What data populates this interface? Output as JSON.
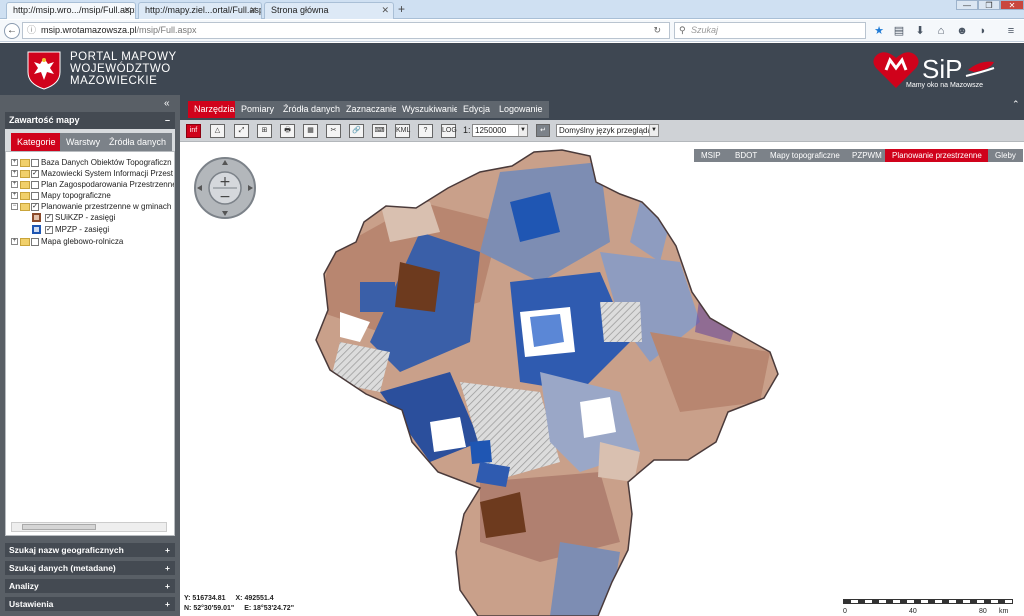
{
  "browser": {
    "tabs": [
      {
        "label": "http://msip.wro.../msip/Full.aspx",
        "active": true
      },
      {
        "label": "http://mapy.ziel...ortal/Full.aspx",
        "active": false
      },
      {
        "label": "Strona główna",
        "active": false
      }
    ],
    "new_tab": "+",
    "url_domain": "msip.wrotamazowsza.pl",
    "url_path": "/msip/Full.aspx",
    "search_placeholder": "Szukaj"
  },
  "portal": {
    "title_lines": [
      "PORTAL MAPOWY",
      "WOJEWÓDZTWO",
      "MAZOWIECKIE"
    ],
    "logo_text": "SiP",
    "logo_tagline": "Mamy oko na Mazowsze",
    "brand_color": "#d0021b"
  },
  "left_panel": {
    "collapse_glyph": "«",
    "header": "Zawartość mapy",
    "header_toggle": "–",
    "tabs": [
      "Kategorie",
      "Warstwy",
      "Źródła danych"
    ],
    "tree": [
      {
        "label": "Baza Danych Obiektów Topograficzn",
        "checked": false,
        "expanded": false,
        "indent": 0
      },
      {
        "label": "Mazowiecki System Informacji Przest",
        "checked": true,
        "expanded": false,
        "indent": 0
      },
      {
        "label": "Plan Zagospodarowania Przestrzenne",
        "checked": false,
        "expanded": false,
        "indent": 0
      },
      {
        "label": "Mapy topograficzne",
        "checked": false,
        "expanded": false,
        "indent": 0
      },
      {
        "label": "Planowanie przestrzenne w gminach",
        "checked": true,
        "expanded": true,
        "indent": 0
      },
      {
        "label": "SUiKZP - zasięgi",
        "checked": true,
        "swatch": "#8b4a2b",
        "indent": 1
      },
      {
        "label": "MPZP - zasięgi",
        "checked": true,
        "swatch": "#1f56b3",
        "indent": 1
      },
      {
        "label": "Mapa glebowo-rolnicza",
        "checked": false,
        "expanded": false,
        "indent": 0
      }
    ],
    "sections": [
      {
        "label": "Szukaj nazw geograficznych",
        "toggle": "+"
      },
      {
        "label": "Szukaj danych (metadane)",
        "toggle": "+"
      },
      {
        "label": "Analizy",
        "toggle": "+"
      },
      {
        "label": "Ustawienia",
        "toggle": "+"
      }
    ]
  },
  "menu": {
    "items": [
      "Narzędzia",
      "Pomiary",
      "Źródła danych",
      "Zaznaczanie",
      "Wyszukiwanie",
      "Edycja",
      "Logowanie"
    ],
    "collapse_glyph": "⌃"
  },
  "toolbar": {
    "tools": [
      "inf",
      "△",
      "⤢",
      "⊞",
      "🖶",
      "▦",
      "✂",
      "🔗",
      "⌨",
      "KML",
      "?",
      "LOG"
    ],
    "scale_prefix": "1:",
    "scale_value": "1250000",
    "language": "Domyślny język przeglądarki"
  },
  "map": {
    "layer_buttons": [
      "MSIP",
      "BDOT",
      "Mapy topograficzne",
      "PZPWM",
      "Planowanie przestrzenne",
      "Gleby"
    ],
    "active_layer": "Planowanie przestrzenne",
    "coords": {
      "y": "Y: 516734.81",
      "x": "X: 492551.4",
      "n": "N: 52°30'59.01\"",
      "e": "E: 18°53'24.72\""
    },
    "scale_labels": [
      "0",
      "40",
      "80",
      "km"
    ]
  }
}
